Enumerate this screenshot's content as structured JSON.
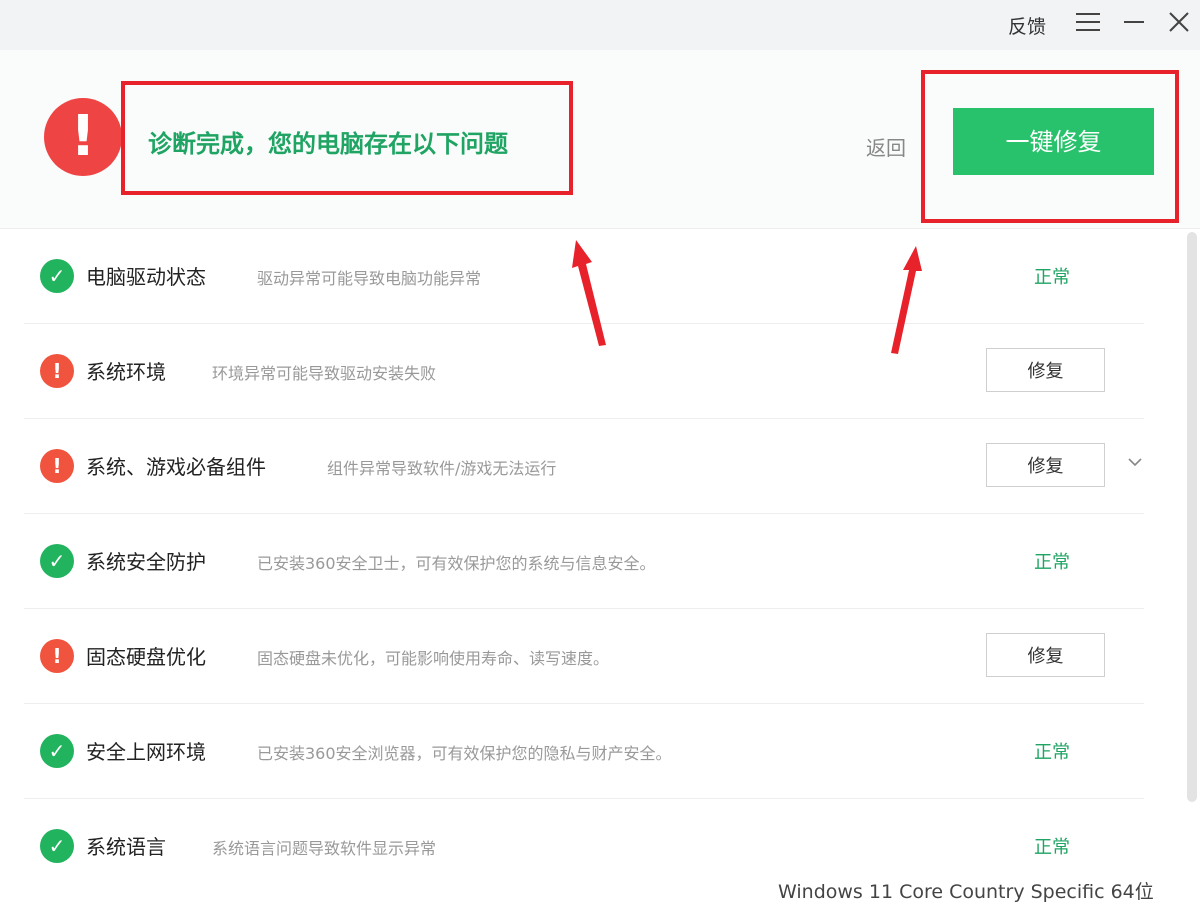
{
  "titlebar": {
    "feedback_label": "反馈",
    "menu_icon": "hamburger-menu-icon",
    "minimize_icon": "minimize-icon",
    "close_icon": "close-icon"
  },
  "header": {
    "status_icon": "exclamation-icon",
    "status_text": "诊断完成，您的电脑存在以下问题",
    "back_label": "返回",
    "fix_all_label": "一键修复"
  },
  "colors": {
    "accent_green": "#27c26b",
    "ok_green": "#22b35e",
    "warn_red": "#f0533e",
    "annotation_red": "#e8222a"
  },
  "items": [
    {
      "title": "电脑驱动状态",
      "desc": "驱动异常可能导致电脑功能异常",
      "state": "ok",
      "status": "正常"
    },
    {
      "title": "系统环境",
      "desc": "环境异常可能导致驱动安装失败",
      "state": "warn",
      "action": "修复"
    },
    {
      "title": "系统、游戏必备组件",
      "desc": "组件异常导致软件/游戏无法运行",
      "state": "warn",
      "action": "修复",
      "expandable": true
    },
    {
      "title": "系统安全防护",
      "desc": "已安装360安全卫士，可有效保护您的系统与信息安全。",
      "state": "ok",
      "status": "正常"
    },
    {
      "title": "固态硬盘优化",
      "desc": "固态硬盘未优化，可能影响使用寿命、读写速度。",
      "state": "warn",
      "action": "修复"
    },
    {
      "title": "安全上网环境",
      "desc": "已安装360安全浏览器，可有效保护您的隐私与财产安全。",
      "state": "ok",
      "status": "正常"
    },
    {
      "title": "系统语言",
      "desc": "系统语言问题导致软件显示异常",
      "state": "ok",
      "status": "正常"
    }
  ],
  "footer": {
    "system_info": "Windows 11 Core Country Specific 64位"
  }
}
